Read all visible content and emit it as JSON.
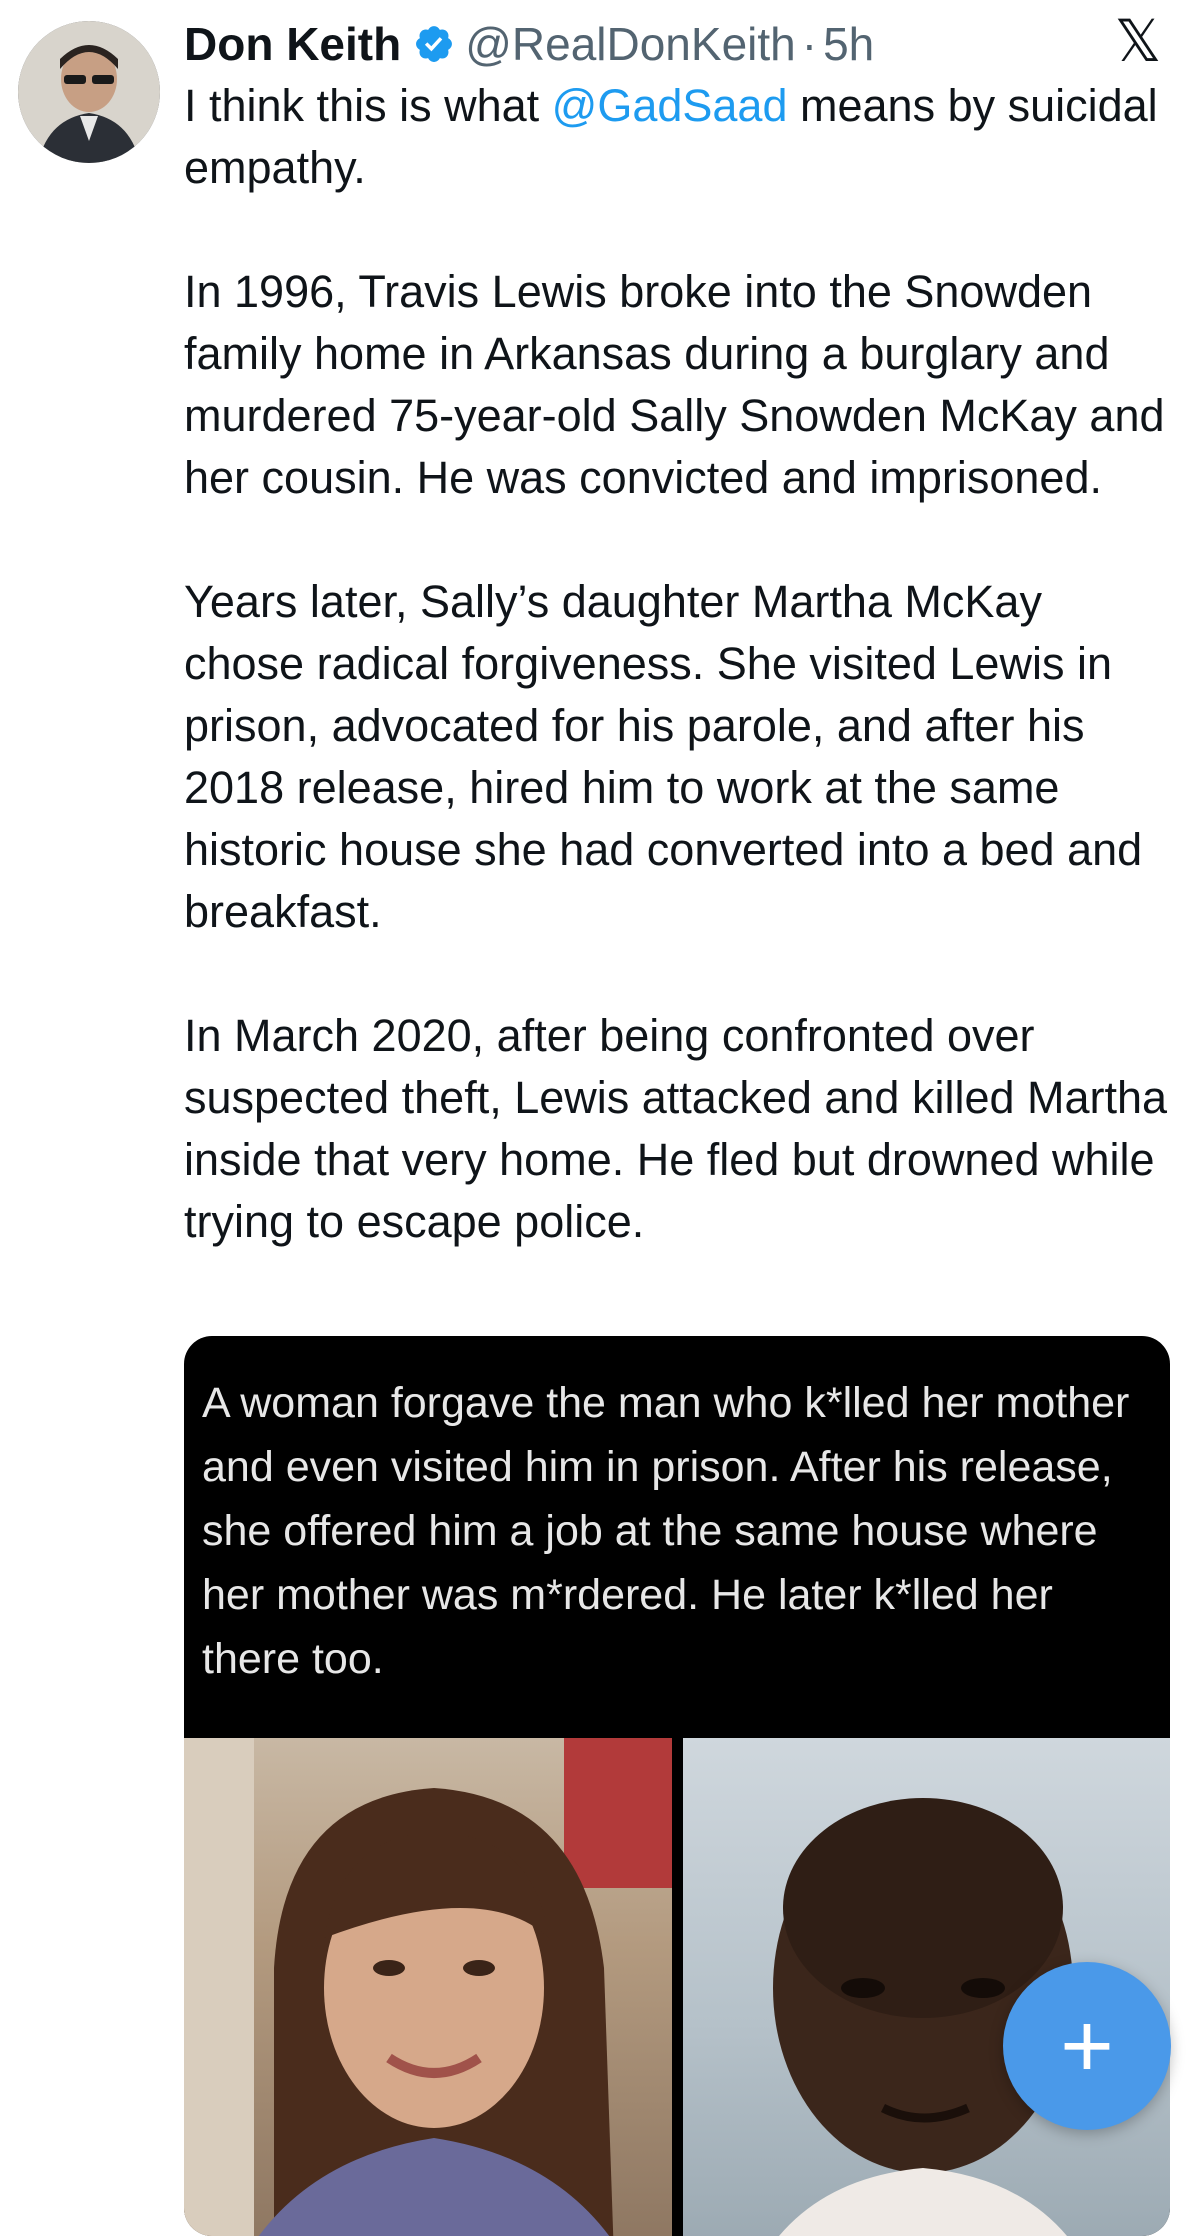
{
  "tweet": {
    "author_name": "Don Keith",
    "handle": "@RealDonKeith",
    "separator": "·",
    "time": "5h",
    "text_p1_a": "I think this is what ",
    "text_p1_mention": "@GadSaad",
    "text_p1_b": " means by suicidal empathy.",
    "text_p2": "In 1996, Travis Lewis broke into the Snowden family home in Arkansas during a burglary and murdered 75-year-old Sally Snowden McKay and her cousin. He was convicted and imprisoned.",
    "text_p3": "Years later, Sally’s daughter Martha McKay chose radical forgiveness. She visited Lewis in prison, advocated for his parole, and after his 2018 release, hired him to work at the same historic house she had converted into a bed and breakfast.",
    "text_p4": "In March 2020, after being confronted over suspected theft, Lewis attacked and killed Martha inside that very home. He fled but drowned while trying to escape police."
  },
  "media": {
    "caption": "A woman forgave the man who k*lled her mother and even visited him in prison. After his release, she offered him a job at the same house where her mother was m*rdered. He later k*lled her there too."
  },
  "ui": {
    "close_glyph": "𝕏",
    "fab_glyph": "+",
    "accent_color": "#1d9bf0",
    "fab_color": "#4a99e9"
  }
}
